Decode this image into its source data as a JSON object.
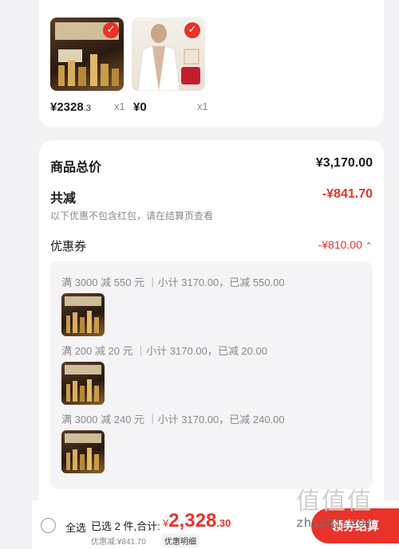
{
  "products": [
    {
      "price": "¥2328",
      "price_decimal": ".3",
      "qty": "x1",
      "checked_icon": "check-icon"
    },
    {
      "price": "¥0",
      "price_decimal": "",
      "qty": "x1",
      "checked_icon": "check-icon"
    }
  ],
  "summary": {
    "total_label": "商品总价",
    "total_value": "¥3,170.00",
    "discount_label": "共减",
    "discount_value": "-¥841.70",
    "discount_note": "以下优惠不包含红包，请在结算页查看",
    "coupon_label": "优惠券",
    "coupon_value": "-¥810.00",
    "coupon_toggle": "⌃"
  },
  "coupons": [
    {
      "rule": "满 3000 减 550 元 ｜小计 3170.00，已减 550.00"
    },
    {
      "rule": "满 200 减 20 元 ｜小计 3170.00，已减 20.00"
    },
    {
      "rule": "满 3000 减 240 元 ｜小计 3170.00，已减 240.00"
    }
  ],
  "bottom_bar": {
    "select_all": "全选",
    "selected": "已选 2 件,合计:",
    "total_symbol": "¥",
    "total_int": "2,328",
    "total_dec": ".30",
    "discount_line": "优惠减:¥841.70",
    "detail_link": "优惠明细",
    "checkout": "领券结算"
  },
  "watermark": {
    "glyphs": "值值值",
    "site": "zhizhi.com"
  },
  "colors": {
    "accent": "#e8322a",
    "background": "#f3f3f5"
  }
}
